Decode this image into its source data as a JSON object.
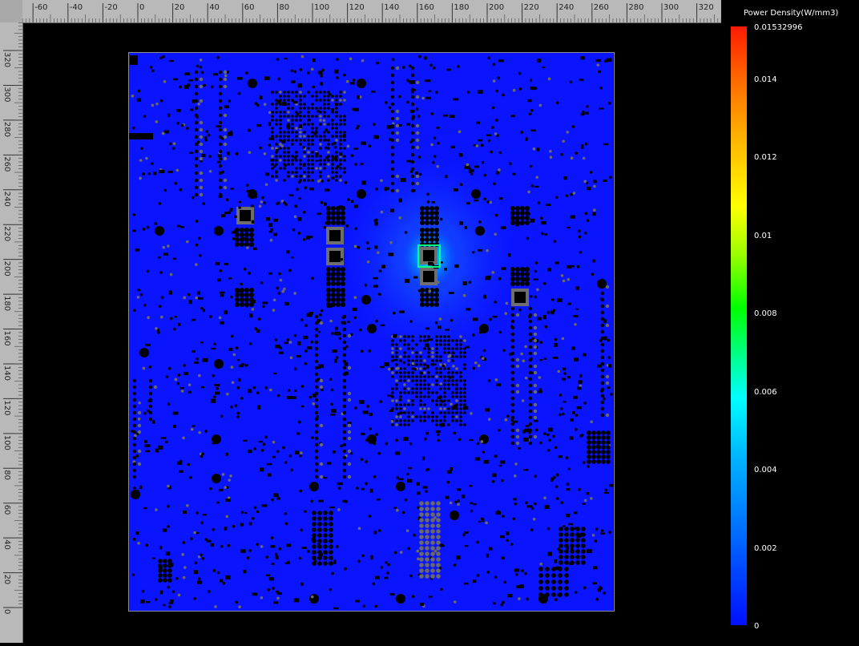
{
  "ruler_top": {
    "labels": [
      "-60",
      "-40",
      "-20",
      "0",
      "20",
      "40",
      "60",
      "80",
      "100",
      "120",
      "140",
      "160",
      "180",
      "200",
      "220",
      "240",
      "260",
      "280",
      "300",
      "320"
    ]
  },
  "ruler_left": {
    "labels": [
      "320",
      "300",
      "280",
      "260",
      "240",
      "220",
      "200",
      "180",
      "160",
      "140",
      "120",
      "100",
      "80",
      "60",
      "40",
      "20",
      "0"
    ]
  },
  "legend": {
    "title": "Power Density(W/mm3)",
    "max_label": "0.01532996",
    "ticks": [
      "0.014",
      "0.012",
      "0.01",
      "0.008",
      "0.006",
      "0.004",
      "0.002",
      "0"
    ]
  },
  "colors": {
    "board_fill": "#0a14ff",
    "hotspot": "#00ffcc",
    "component_dark": "#000000",
    "component_pad": "#7a7a7a",
    "ruler_bg": "#b9b9b9"
  },
  "icons": [
    "ruler-top",
    "ruler-left",
    "power-density-colorbar"
  ]
}
